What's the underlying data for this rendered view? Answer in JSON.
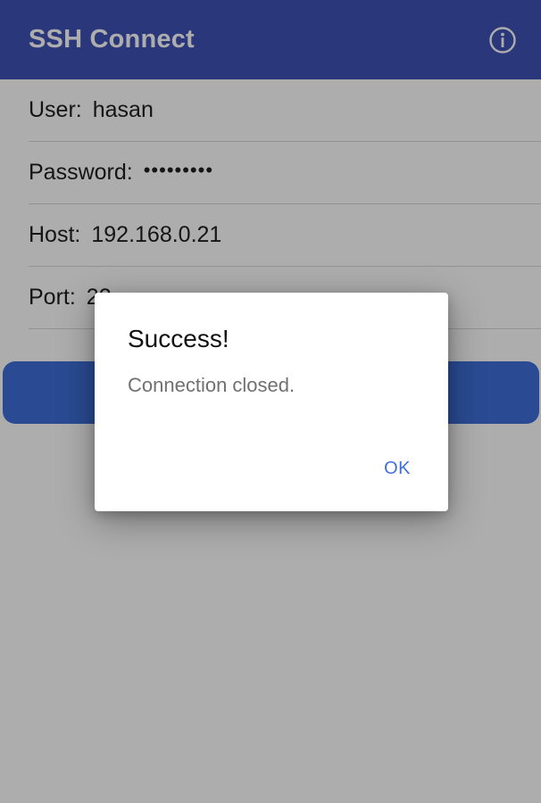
{
  "app_bar": {
    "title": "SSH Connect",
    "info_icon": "info-icon",
    "color": "#3f51b5"
  },
  "form": {
    "user": {
      "label": "User:",
      "value": "hasan"
    },
    "password": {
      "label": "Password:",
      "value": "•••••••••"
    },
    "host": {
      "label": "Host:",
      "value": "192.168.0.21"
    },
    "port": {
      "label": "Port:",
      "value": "22"
    }
  },
  "connect_button": {
    "color": "#3f6fd9"
  },
  "dialog": {
    "title": "Success!",
    "message": "Connection closed.",
    "ok_label": "OK"
  }
}
